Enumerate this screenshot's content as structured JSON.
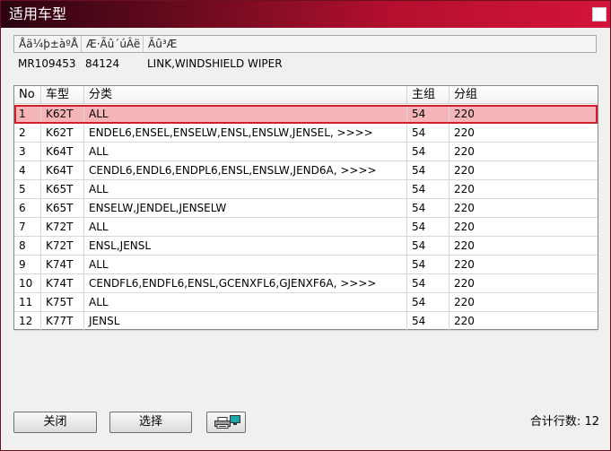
{
  "window": {
    "title": "适用车型"
  },
  "part_info": {
    "headers": [
      "Åä¼þ±àºÅ",
      "Æ·Ãû´úÂë",
      "Ãû³Æ"
    ],
    "values": [
      "MR109453",
      "84124",
      "LINK,WINDSHIELD WIPER"
    ]
  },
  "table": {
    "headers": [
      "No",
      "车型",
      "分类",
      "主组",
      "分组"
    ],
    "rows": [
      {
        "no": "1",
        "model": "K62T",
        "cls": "ALL",
        "main": "54",
        "sub": "220"
      },
      {
        "no": "2",
        "model": "K62T",
        "cls": "ENDEL6,ENSEL,ENSELW,ENSL,ENSLW,JENSEL,  >>>>",
        "main": "54",
        "sub": "220"
      },
      {
        "no": "3",
        "model": "K64T",
        "cls": "ALL",
        "main": "54",
        "sub": "220"
      },
      {
        "no": "4",
        "model": "K64T",
        "cls": "CENDL6,ENDL6,ENDPL6,ENSL,ENSLW,JEND6A,  >>>>",
        "main": "54",
        "sub": "220"
      },
      {
        "no": "5",
        "model": "K65T",
        "cls": "ALL",
        "main": "54",
        "sub": "220"
      },
      {
        "no": "6",
        "model": "K65T",
        "cls": "ENSELW,JENDEL,JENSELW",
        "main": "54",
        "sub": "220"
      },
      {
        "no": "7",
        "model": "K72T",
        "cls": "ALL",
        "main": "54",
        "sub": "220"
      },
      {
        "no": "8",
        "model": "K72T",
        "cls": "ENSL,JENSL",
        "main": "54",
        "sub": "220"
      },
      {
        "no": "9",
        "model": "K74T",
        "cls": "ALL",
        "main": "54",
        "sub": "220"
      },
      {
        "no": "10",
        "model": "K74T",
        "cls": "CENDFL6,ENDFL6,ENSL,GCENXFL6,GJENXF6A,  >>>>",
        "main": "54",
        "sub": "220"
      },
      {
        "no": "11",
        "model": "K75T",
        "cls": "ALL",
        "main": "54",
        "sub": "220"
      },
      {
        "no": "12",
        "model": "K77T",
        "cls": "JENSL",
        "main": "54",
        "sub": "220"
      }
    ],
    "selected_row": 0
  },
  "footer": {
    "close_label": "关闭",
    "select_label": "选择",
    "print_icon": "printer-icon",
    "count_label": "合计行数:",
    "count_value": "12"
  },
  "colors": {
    "title_gradient_start": "#2a0410",
    "title_gradient_end": "#d4143a",
    "selected_row_bg": "#f4b4b8",
    "selected_row_border": "#d2202a"
  }
}
